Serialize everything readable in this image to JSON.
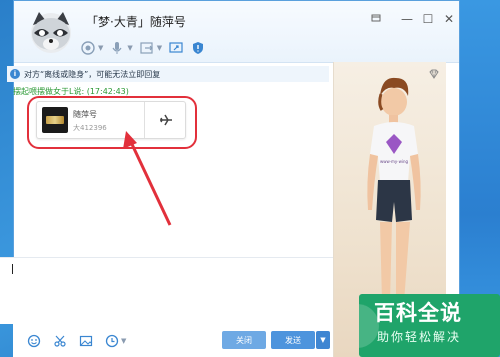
{
  "window": {
    "title": "「梦·大青」随萍号",
    "min_glyph": "—",
    "max_glyph": "☐",
    "close_glyph": "✕"
  },
  "toolbar": {
    "items": [
      "camera-icon",
      "microphone-icon",
      "transfer-icon",
      "remote-desktop-icon",
      "security-icon"
    ]
  },
  "chat": {
    "info_text": "对方“离线或隐身”，可能无法立即回复",
    "sender_line": "摆起喂摆做女于L说: (17:42:43)",
    "file": {
      "name": "随萍号",
      "size": "大412396"
    }
  },
  "bottom": {
    "tools": [
      "emoji-icon",
      "scissors-icon",
      "image-icon",
      "clock-icon"
    ],
    "close_label": "关闭",
    "send_label": "发送",
    "send_dropdown": "▼"
  },
  "watermark": {
    "title": "百科全说",
    "subtitle": "助你轻松解决"
  },
  "colors": {
    "accent": "#4d94dd",
    "highlight": "#e2303b",
    "sender": "#2d9a36",
    "watermark": "#1fa46a"
  }
}
